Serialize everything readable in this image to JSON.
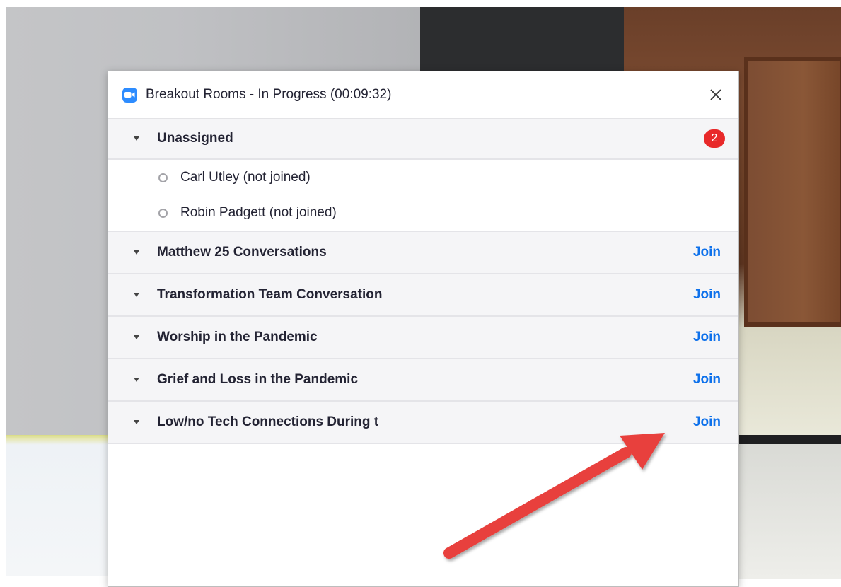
{
  "dialog": {
    "title": "Breakout Rooms - In Progress (00:09:32)",
    "close_icon": "close-icon",
    "app_icon": "zoom-camera-icon"
  },
  "unassigned": {
    "label": "Unassigned",
    "badge_count": "2",
    "participants": [
      {
        "name": "Carl Utley (not joined)"
      },
      {
        "name": "Robin Padgett (not joined)"
      }
    ]
  },
  "rooms": [
    {
      "name": "Matthew 25 Conversations",
      "join_label": "Join"
    },
    {
      "name": "Transformation Team Conversation",
      "join_label": "Join"
    },
    {
      "name": "Worship in the Pandemic",
      "join_label": "Join"
    },
    {
      "name": "Grief and Loss in the Pandemic",
      "join_label": "Join"
    },
    {
      "name": "Low/no Tech Connections During t",
      "join_label": "Join"
    }
  ],
  "colors": {
    "accent_blue": "#0e71eb",
    "badge_red": "#e8292a",
    "annotation_arrow": "#e8413c"
  }
}
